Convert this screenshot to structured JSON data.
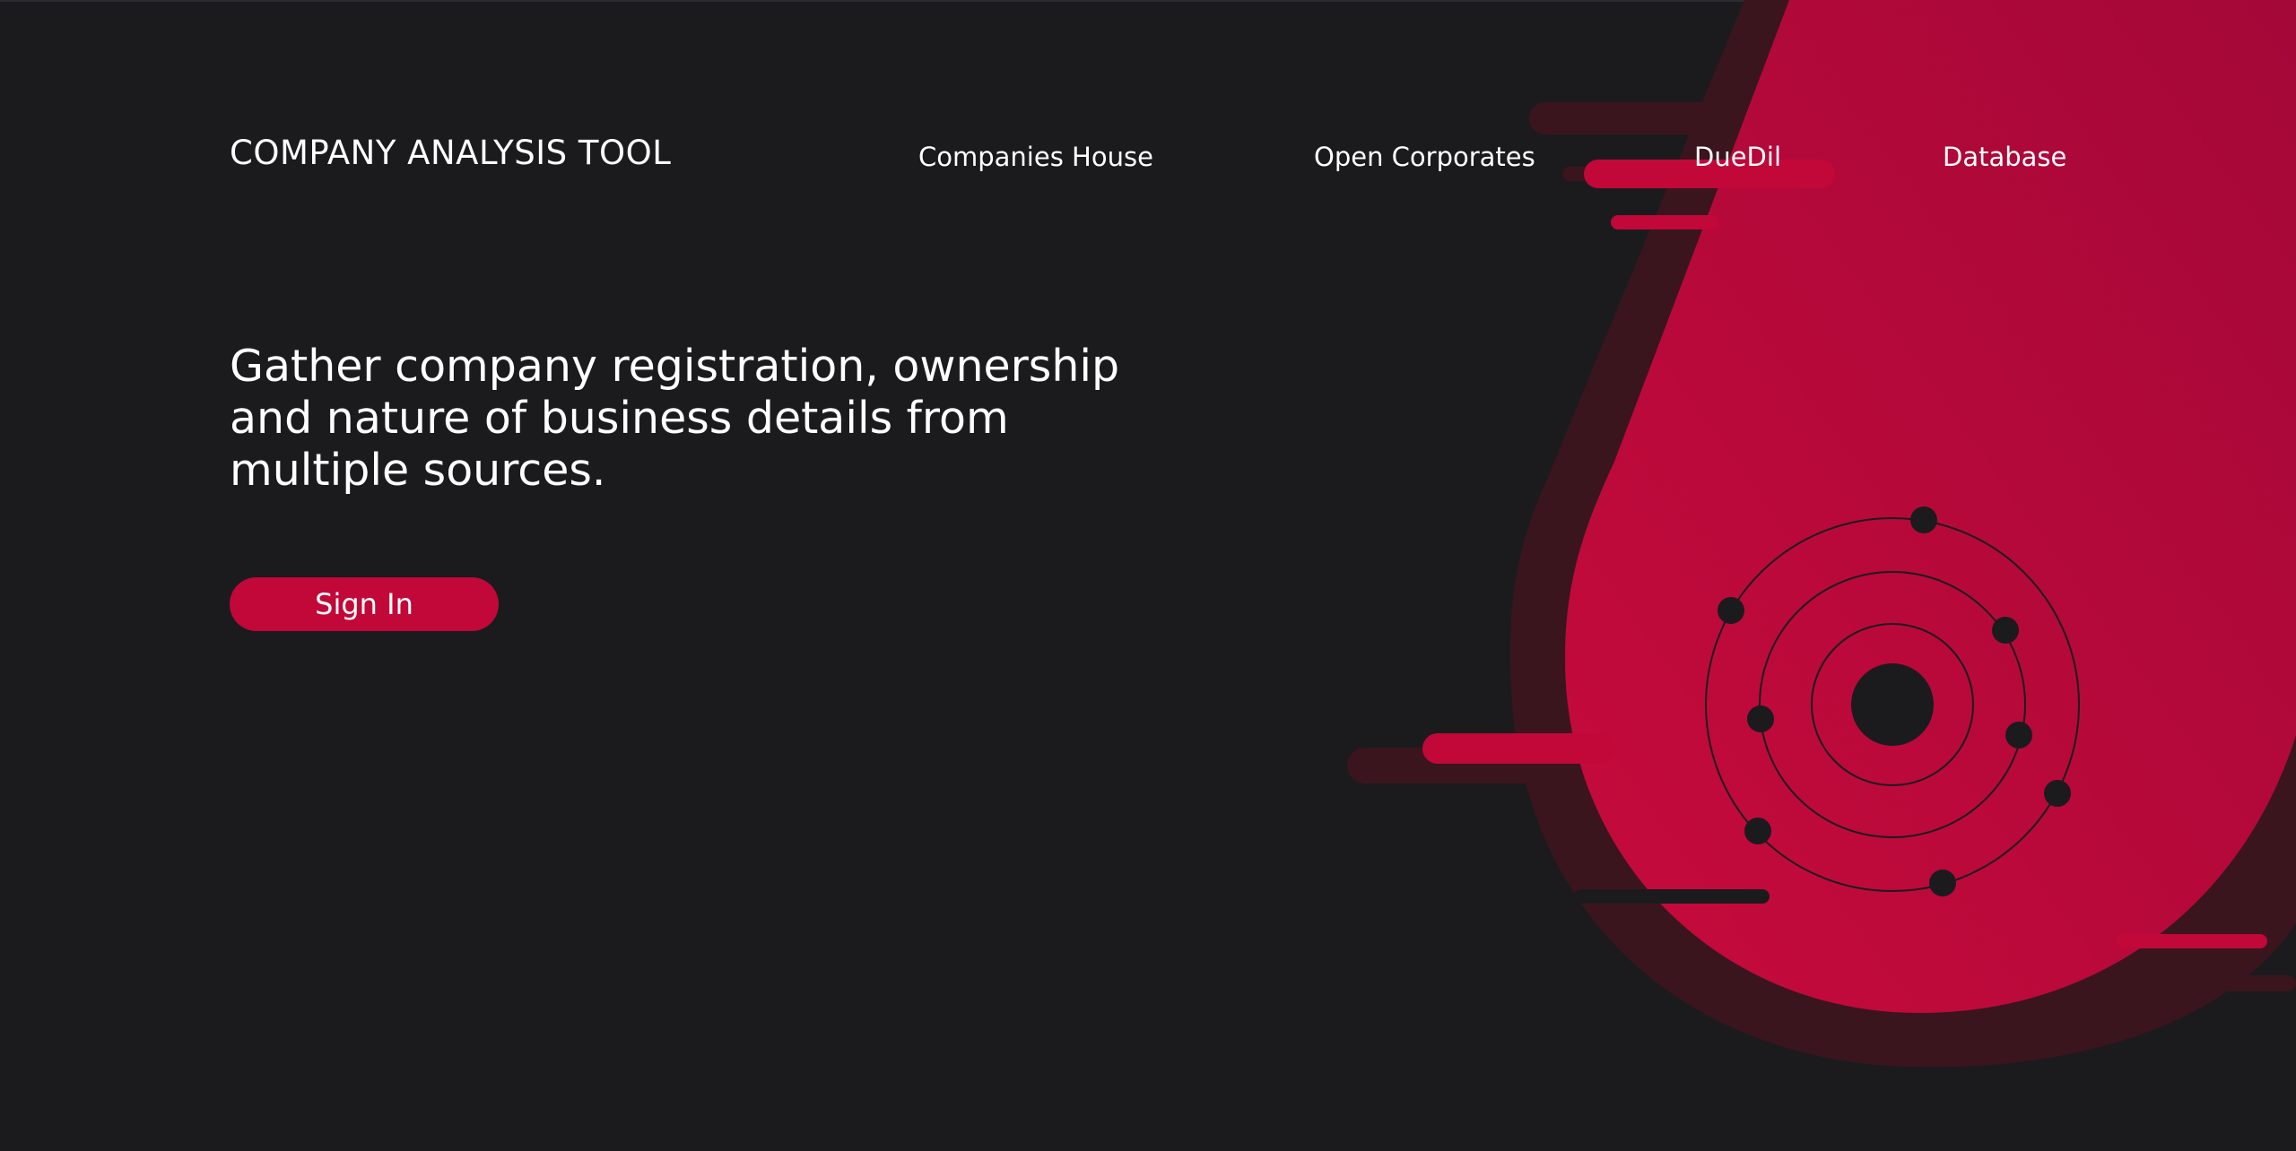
{
  "header": {
    "brand": "COMPANY ANALYSIS TOOL",
    "nav": [
      {
        "label": "Companies House"
      },
      {
        "label": "Open Corporates"
      },
      {
        "label": "DueDil"
      },
      {
        "label": "Database"
      }
    ]
  },
  "hero": {
    "headline": "Gather company registration, ownership and nature of business details from multiple sources.",
    "signin_label": "Sign In"
  },
  "theme": {
    "background": "#1b1b1e",
    "accent": "#c10838",
    "accent_dark": "#3a151e",
    "text": "#ffffff"
  },
  "illustration": {
    "icon": "orbit-network-icon"
  }
}
